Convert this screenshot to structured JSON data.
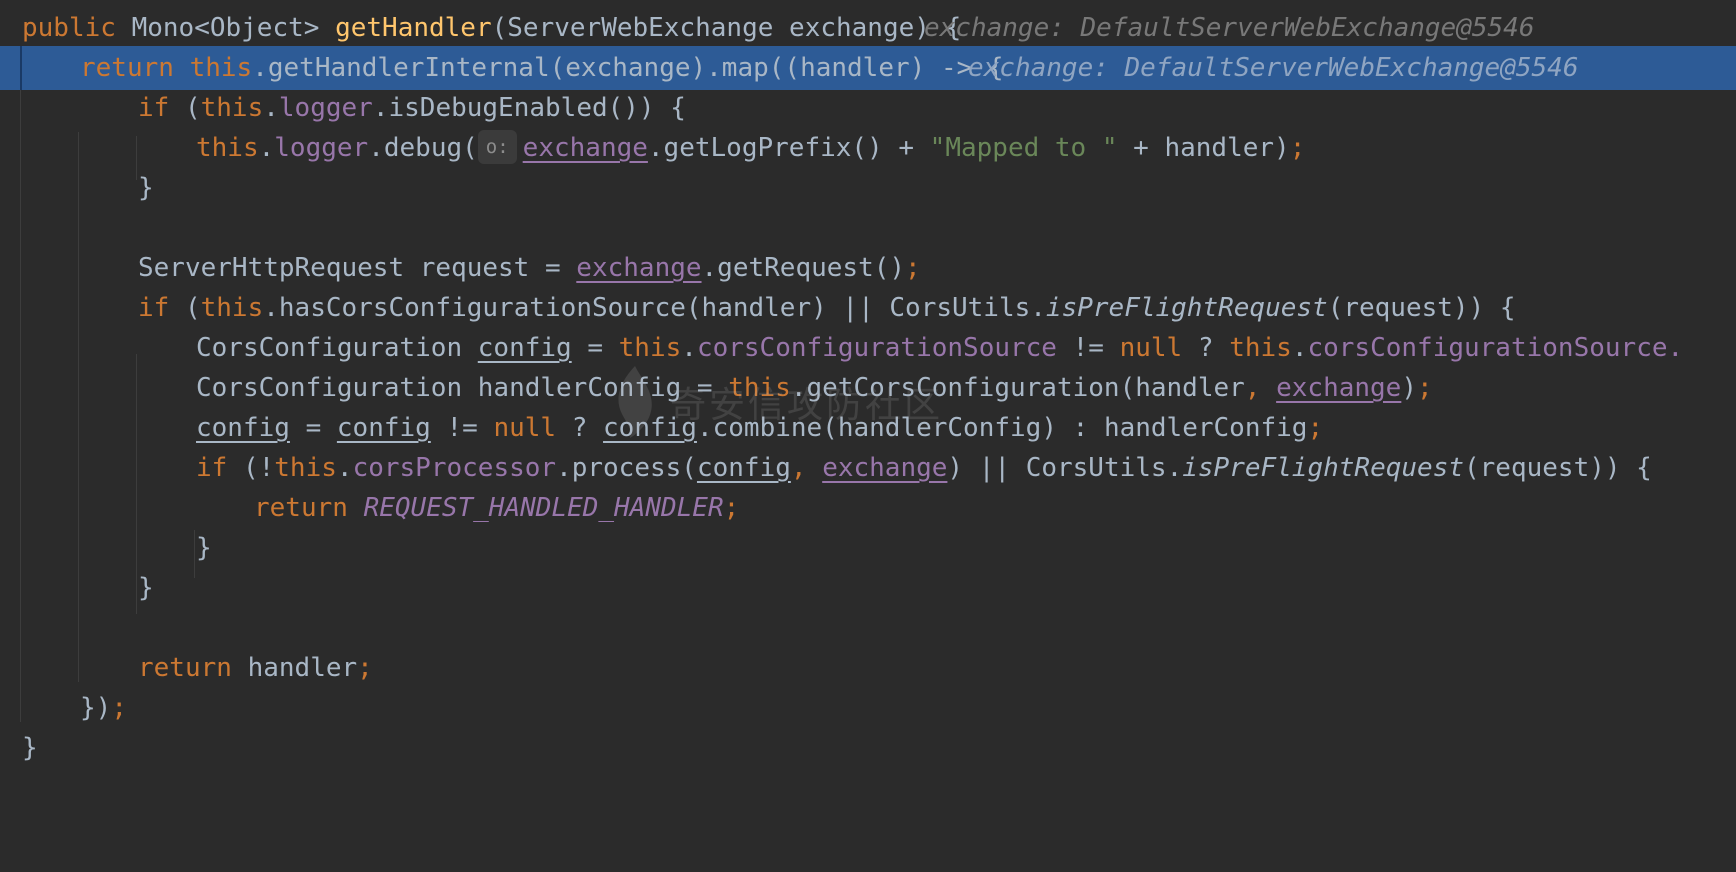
{
  "editor": {
    "theme_colors": {
      "background": "#2b2b2b",
      "current_line": "#2d5b96",
      "keyword": "#cc7832",
      "method_decl": "#ffc66d",
      "field": "#9876aa",
      "string": "#6a8759",
      "text": "#a9b7c6"
    },
    "lines": {
      "l1": {
        "public": "public",
        "type": "Mono<Object>",
        "method": "getHandler",
        "sig": "(ServerWebExchange exchange) {",
        "hint": "exchange: DefaultServerWebExchange@5546"
      },
      "l2": {
        "return": "return",
        "this": "this",
        "rest": ".getHandlerInternal(exchange).map((handler) -> {",
        "hint": "exchange: DefaultServerWebExchange@5546"
      },
      "l3": {
        "if": "if",
        "open": " (",
        "this": "this",
        "dot": ".",
        "logger": "logger",
        "rest": ".isDebugEnabled()) {"
      },
      "l4": {
        "this": "this",
        "dot": ".",
        "logger": "logger",
        "call": ".debug(",
        "param_hint": "o:",
        "exchange": "exchange",
        "mid": ".getLogPrefix() + ",
        "string": "\"Mapped to \"",
        "tail": " + handler)",
        "semi": ";"
      },
      "l5": {
        "brace": "}"
      },
      "l7": {
        "decl": "ServerHttpRequest request = ",
        "exchange": "exchange",
        "call": ".getRequest()",
        "semi": ";"
      },
      "l8": {
        "if": "if",
        "open": " (",
        "this": "this",
        "mid": ".hasCorsConfigurationSource(handler) || CorsUtils.",
        "method": "isPreFlightRequest",
        "tail": "(request)) {"
      },
      "l9": {
        "type": "CorsConfiguration ",
        "config": "config",
        "eq": " = ",
        "this1": "this",
        "dot1": ".",
        "field1": "corsConfigurationSource",
        "neq": " != ",
        "null": "null",
        "q": " ? ",
        "this2": "this",
        "dot2": ".",
        "field2": "corsConfigurationSource."
      },
      "l10": {
        "decl": "CorsConfiguration handlerConfig = ",
        "this": "this",
        "call": ".getCorsConfiguration(handler",
        "comma": ", ",
        "exchange": "exchange",
        "close": ")",
        "semi": ";"
      },
      "l11": {
        "config1": "config",
        "eq": " = ",
        "config2": "config",
        "neq": " != ",
        "null": "null",
        "q": " ? ",
        "config3": "config",
        "tail": ".combine(handlerConfig) : handlerConfig",
        "semi": ";"
      },
      "l12": {
        "if": "if",
        "open": " (!",
        "this": "this",
        "dot": ".",
        "field": "corsProcessor",
        "call": ".process(",
        "config": "config",
        "comma": ", ",
        "exchange": "exchange",
        "mid": ") || CorsUtils.",
        "method": "isPreFlightRequest",
        "tail": "(request)) {"
      },
      "l13": {
        "return": "return",
        "constant": "REQUEST_HANDLED_HANDLER",
        "semi": ";"
      },
      "l14": {
        "brace": "}"
      },
      "l15": {
        "brace": "}"
      },
      "l17": {
        "return": "return",
        "value": " handler",
        "semi": ";"
      },
      "l18": {
        "close": "})",
        "semi": ";"
      },
      "l19": {
        "brace": "}"
      }
    },
    "watermark_text": "奇安信攻防社区"
  }
}
